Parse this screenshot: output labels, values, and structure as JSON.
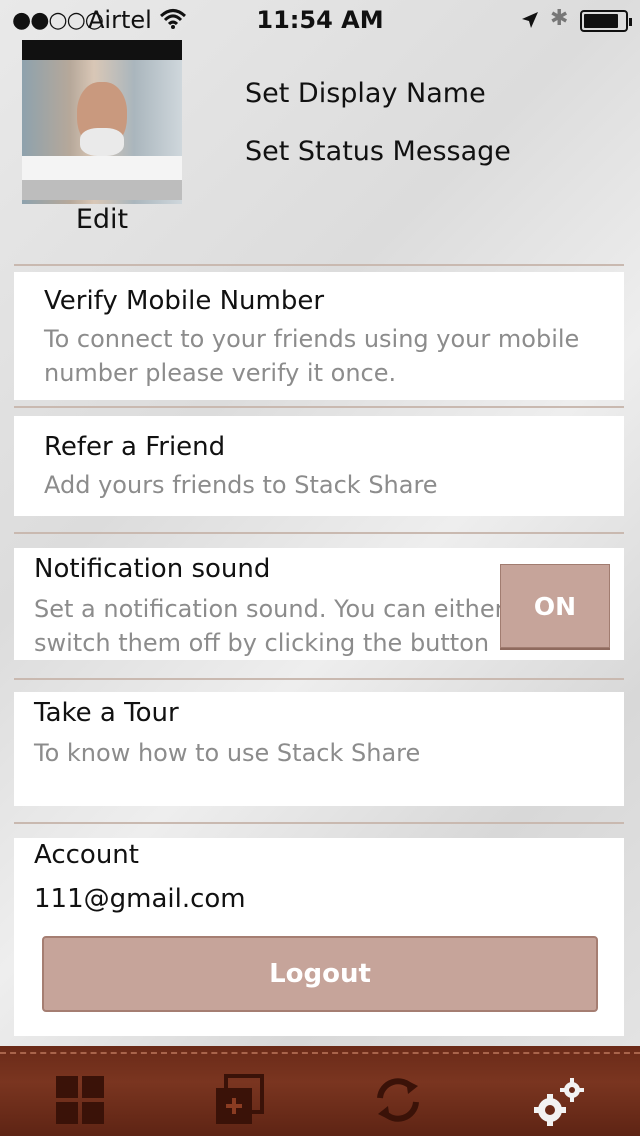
{
  "status_bar": {
    "signal": "●●○○○",
    "carrier": "Airtel",
    "time": "11:54 AM",
    "bluetooth": "✱"
  },
  "profile": {
    "edit_label": "Edit",
    "display_name_label": "Set Display Name",
    "status_message_label": "Set Status Message"
  },
  "settings": {
    "verify": {
      "title": "Verify Mobile Number",
      "subtitle_line1": "To connect to your friends using your mobile",
      "subtitle_line2": "number please verify it once."
    },
    "refer": {
      "title": "Refer a Friend",
      "subtitle": "Add yours friends to Stack Share"
    },
    "notification": {
      "title": "Notification sound",
      "subtitle_line1": "Set a notification sound. You can either",
      "subtitle_line2": "switch them off by clicking the button",
      "toggle_label": "ON"
    },
    "tour": {
      "title": "Take a Tour",
      "subtitle": "To know how to use Stack Share"
    },
    "account": {
      "title": "Account",
      "email": "111@gmail.com",
      "logout_label": "Logout"
    }
  },
  "tabbar": {
    "tabs": [
      {
        "icon": "grid-icon"
      },
      {
        "icon": "add-stack-icon"
      },
      {
        "icon": "sync-icon"
      },
      {
        "icon": "settings-gears-icon",
        "active": true
      }
    ]
  },
  "colors": {
    "button": "#c6a49a",
    "tabbar": "#6a2a18",
    "subtitle": "#8c8c8c"
  }
}
